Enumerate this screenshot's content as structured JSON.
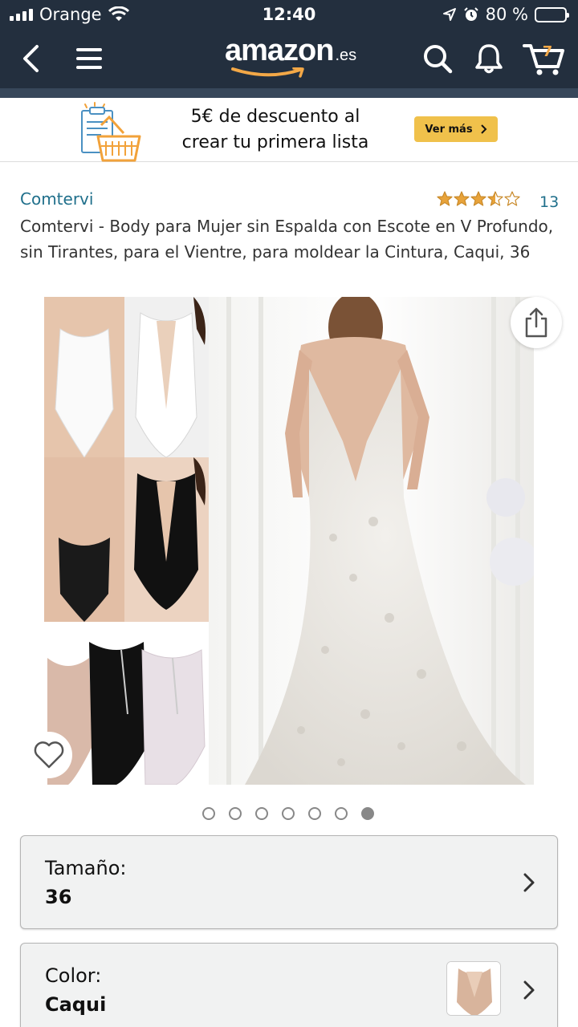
{
  "status_bar": {
    "carrier": "Orange",
    "time": "12:40",
    "battery": "80 %",
    "battery_level": 0.8
  },
  "nav": {
    "logo_text": "amazon",
    "logo_tld": ".es",
    "cart_count": "7"
  },
  "promo": {
    "line1": "5€ de descuento al",
    "line2": "crear tu primera lista",
    "cta_label": "Ver más",
    "cta_color": "#f0c14b"
  },
  "product": {
    "brand": "Comtervi",
    "rating": 3.5,
    "review_count": "13",
    "title": "Comtervi - Body para Mujer sin Espalda con Escote en V Profundo, sin Tirantes, para el Vientre, para moldear la Cintura, Caqui, 36"
  },
  "gallery": {
    "image_count": 7,
    "active_index": 6,
    "icons": [
      "share-icon",
      "heart-icon"
    ]
  },
  "options": {
    "size_label": "Tamaño:",
    "size_value": "36",
    "color_label": "Color:",
    "color_value": "Caqui"
  },
  "colors": {
    "header": "#232f3e",
    "link": "#1f6f8b",
    "star": "#e8a33a"
  }
}
